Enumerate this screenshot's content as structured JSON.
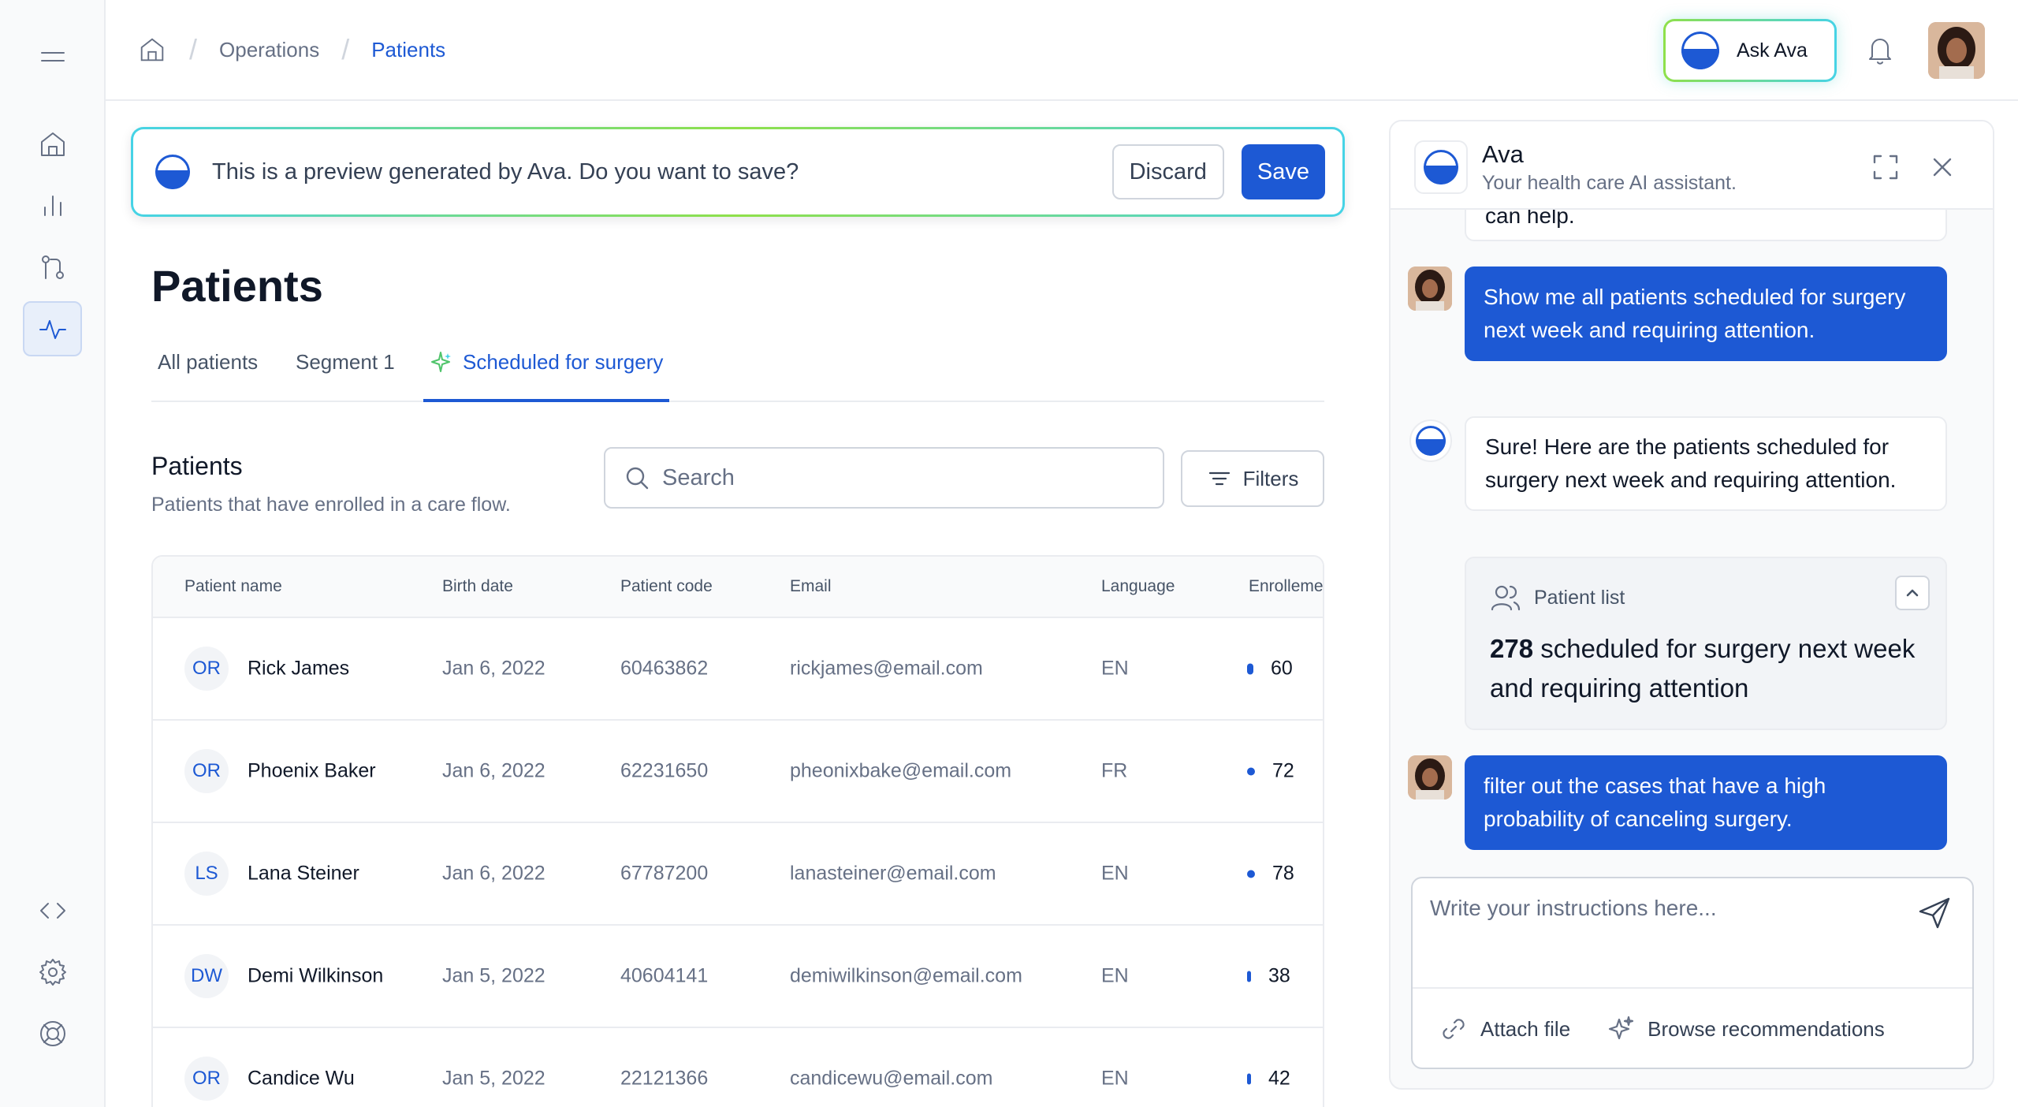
{
  "colors": {
    "accent": "#1d59d4",
    "ava_gradient_start": "#8fe04a",
    "ava_gradient_end": "#46d3e6",
    "text_muted": "#667085"
  },
  "sidebar": {
    "items": [
      {
        "icon": "menu-icon"
      },
      {
        "icon": "home-icon"
      },
      {
        "icon": "bar-chart-icon"
      },
      {
        "icon": "git-flow-icon"
      },
      {
        "icon": "activity-icon",
        "active": true
      },
      {
        "icon": "code-icon"
      },
      {
        "icon": "gear-icon"
      },
      {
        "icon": "lifebuoy-icon"
      }
    ]
  },
  "breadcrumb": {
    "home_icon": "home-icon",
    "items": [
      "Operations",
      "Patients"
    ]
  },
  "header": {
    "ask_ava_label": "Ask Ava",
    "bell_icon": "bell-icon"
  },
  "banner": {
    "text": "This is a preview generated by Ava. Do you want to save?",
    "discard_label": "Discard",
    "save_label": "Save"
  },
  "page": {
    "title": "Patients",
    "tabs": [
      {
        "label": "All patients"
      },
      {
        "label": "Segment 1"
      },
      {
        "label": "Scheduled for surgery",
        "active": true,
        "icon": "sparkle-icon"
      }
    ]
  },
  "section": {
    "title": "Patients",
    "subtitle": "Patients that have enrolled in a care flow.",
    "search_placeholder": "Search",
    "filters_label": "Filters"
  },
  "table": {
    "columns": [
      "Patient name",
      "Birth date",
      "Patient code",
      "Email",
      "Language",
      "Enrolleme"
    ],
    "rows": [
      {
        "initials": "OR",
        "name": "Rick James",
        "birth_date": "Jan 6, 2022",
        "code": "60463862",
        "email": "rickjames@email.com",
        "language": "EN",
        "enrollment": "60"
      },
      {
        "initials": "OR",
        "name": "Phoenix Baker",
        "birth_date": "Jan 6, 2022",
        "code": "62231650",
        "email": "pheonixbake@email.com",
        "language": "FR",
        "enrollment": "72"
      },
      {
        "initials": "LS",
        "name": "Lana Steiner",
        "birth_date": "Jan 6, 2022",
        "code": "67787200",
        "email": "lanasteiner@email.com",
        "language": "EN",
        "enrollment": "78"
      },
      {
        "initials": "DW",
        "name": "Demi Wilkinson",
        "birth_date": "Jan 5, 2022",
        "code": "40604141",
        "email": "demiwilkinson@email.com",
        "language": "EN",
        "enrollment": "38"
      },
      {
        "initials": "OR",
        "name": "Candice Wu",
        "birth_date": "Jan 5, 2022",
        "code": "22121366",
        "email": "candicewu@email.com",
        "language": "EN",
        "enrollment": "42"
      }
    ]
  },
  "ava_panel": {
    "title": "Ava",
    "subtitle": "Your health care AI assistant.",
    "expand_icon": "expand-icon",
    "close_icon": "close-icon",
    "messages": [
      {
        "from": "bot",
        "text": "can help."
      },
      {
        "from": "user",
        "text": "Show me all patients scheduled for surgery next week and requiring attention."
      },
      {
        "from": "bot",
        "text": "Sure! Here are the patients scheduled for surgery next week and requiring attention."
      },
      {
        "from": "user",
        "text": "filter out the cases that have a high probability of canceling surgery."
      }
    ],
    "patient_list_card": {
      "label": "Patient list",
      "count": "278",
      "text": "scheduled for surgery next week and requiring attention"
    },
    "composer": {
      "placeholder": "Write your instructions here...",
      "attach_label": "Attach file",
      "browse_label": "Browse recommendations"
    }
  }
}
